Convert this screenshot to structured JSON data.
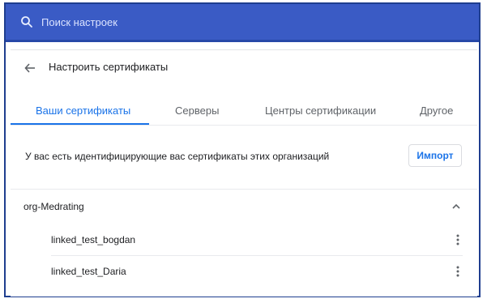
{
  "search": {
    "placeholder": "Поиск настроек"
  },
  "header": {
    "title": "Настроить сертификаты"
  },
  "tabs": [
    {
      "label": "Ваши сертификаты",
      "active": true
    },
    {
      "label": "Серверы",
      "active": false
    },
    {
      "label": "Центры сертификации",
      "active": false
    },
    {
      "label": "Другое",
      "active": false
    }
  ],
  "section": {
    "description": "У вас есть идентифицирующие вас сертификаты этих организаций",
    "import_label": "Импорт"
  },
  "group": {
    "name": "org-Medrating",
    "expanded": true,
    "certificates": [
      {
        "name": "linked_test_bogdan"
      },
      {
        "name": "linked_test_Daria"
      }
    ]
  },
  "colors": {
    "search_bar": "#3a5bc5",
    "accent": "#1a73e8",
    "frame_border": "#1f3e8f"
  },
  "icons": [
    "search-icon",
    "back-arrow-icon",
    "chevron-up-icon",
    "more-vert-icon"
  ]
}
